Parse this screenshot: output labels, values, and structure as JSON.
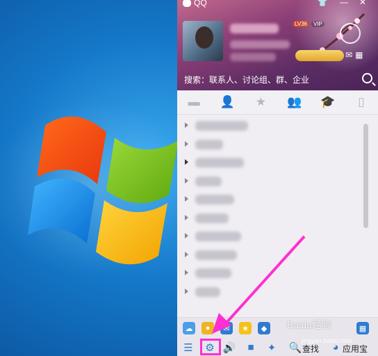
{
  "qq": {
    "title": "QQ",
    "level": "LV36",
    "vip": "VIP",
    "search_placeholder": "搜索：联系人、讨论组、群、企业",
    "tabs": [
      {
        "name": "session",
        "icon": "chat-bubble-icon"
      },
      {
        "name": "contacts",
        "icon": "person-icon",
        "active": true
      },
      {
        "name": "favorites",
        "icon": "star-icon"
      },
      {
        "name": "groups",
        "icon": "group-icon"
      },
      {
        "name": "school",
        "icon": "graduation-cap-icon"
      },
      {
        "name": "device",
        "icon": "phone-icon"
      }
    ],
    "bottom_tools": {
      "search_label": "查找",
      "app_store_label": "应用宝"
    }
  },
  "watermark": {
    "main": "Baidu经验",
    "sub": "jingyan.baidu.com"
  },
  "colors": {
    "accent": "#2f7bd0",
    "highlight": "#ff2fd1"
  }
}
